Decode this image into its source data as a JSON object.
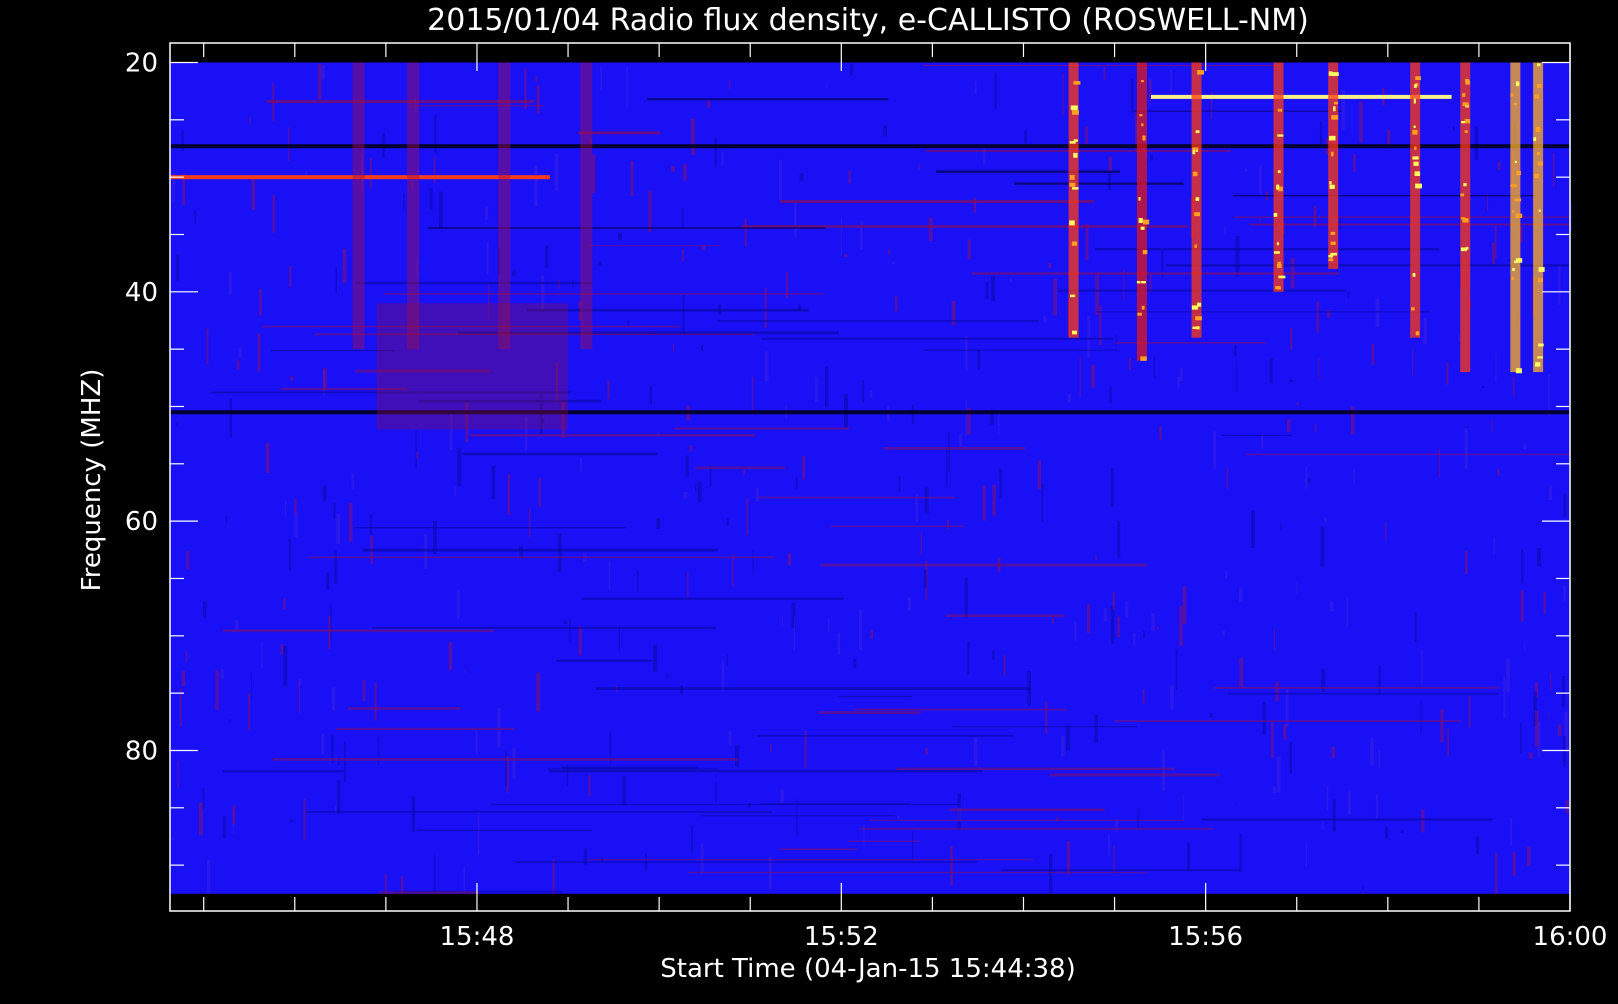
{
  "chart_data": {
    "type": "heatmap",
    "title": "2015/01/04  Radio flux density, e-CALLISTO (ROSWELL-NM)",
    "xlabel": "Start Time (04-Jan-15 15:44:38)",
    "ylabel": "Frequency (MHZ)",
    "x_start": "15:44:38",
    "x_end": "16:00:00",
    "xlim_minutes": [
      44.63,
      60.0
    ],
    "ylim": [
      18.3,
      94.0
    ],
    "y_inverted": true,
    "data_range_mhz": [
      20,
      92.5
    ],
    "x_ticks": [
      {
        "label": "15:48",
        "minute": 48
      },
      {
        "label": "15:52",
        "minute": 52
      },
      {
        "label": "15:56",
        "minute": 56
      },
      {
        "label": "16:00",
        "minute": 60
      }
    ],
    "x_minor_ticks_minutes": [
      45,
      46,
      47,
      49,
      50,
      51,
      53,
      54,
      55,
      57,
      58,
      59
    ],
    "y_ticks": [
      {
        "label": "20",
        "value": 20
      },
      {
        "label": "40",
        "value": 40
      },
      {
        "label": "60",
        "value": 60
      },
      {
        "label": "80",
        "value": 80
      }
    ],
    "y_minor_ticks": [
      25,
      30,
      35,
      45,
      50,
      55,
      65,
      70,
      75,
      85,
      90
    ],
    "colormap": [
      "#000000",
      "#0000ff",
      "#ff0000",
      "#ffff00",
      "#ffffff"
    ],
    "background_color": "#1a10f5",
    "grid": false,
    "features": [
      {
        "kind": "bright_band",
        "freq_mhz": 23.0,
        "start_minute": 55.4,
        "end_minute": 58.7,
        "intensity": "high"
      },
      {
        "kind": "dark_band",
        "freq_mhz": 27.3,
        "start_minute": 44.63,
        "end_minute": 60.0
      },
      {
        "kind": "bright_band",
        "freq_mhz": 30.0,
        "start_minute": 44.63,
        "end_minute": 48.8,
        "intensity": "medium"
      },
      {
        "kind": "dark_band",
        "freq_mhz": 50.5,
        "start_minute": 44.63,
        "end_minute": 60.0
      },
      {
        "kind": "burst_column",
        "minute": 54.55,
        "freq_range_mhz": [
          20,
          44
        ],
        "intensity": "high"
      },
      {
        "kind": "burst_column",
        "minute": 55.3,
        "freq_range_mhz": [
          20,
          46
        ],
        "intensity": "medium"
      },
      {
        "kind": "burst_column",
        "minute": 55.9,
        "freq_range_mhz": [
          20,
          44
        ],
        "intensity": "high"
      },
      {
        "kind": "burst_column",
        "minute": 56.8,
        "freq_range_mhz": [
          20,
          40
        ],
        "intensity": "high"
      },
      {
        "kind": "burst_column",
        "minute": 57.4,
        "freq_range_mhz": [
          20,
          38
        ],
        "intensity": "high"
      },
      {
        "kind": "burst_column",
        "minute": 58.3,
        "freq_range_mhz": [
          20,
          44
        ],
        "intensity": "high"
      },
      {
        "kind": "burst_column",
        "minute": 58.85,
        "freq_range_mhz": [
          20,
          47
        ],
        "intensity": "high"
      },
      {
        "kind": "burst_column",
        "minute": 59.4,
        "freq_range_mhz": [
          20,
          47
        ],
        "intensity": "very_high"
      },
      {
        "kind": "burst_column",
        "minute": 59.65,
        "freq_range_mhz": [
          20,
          47
        ],
        "intensity": "very_high"
      },
      {
        "kind": "weak_column",
        "minute": 46.7,
        "freq_range_mhz": [
          20,
          45
        ],
        "intensity": "low"
      },
      {
        "kind": "weak_column",
        "minute": 47.3,
        "freq_range_mhz": [
          20,
          45
        ],
        "intensity": "low"
      },
      {
        "kind": "weak_column",
        "minute": 48.3,
        "freq_range_mhz": [
          20,
          45
        ],
        "intensity": "low"
      },
      {
        "kind": "weak_column",
        "minute": 49.2,
        "freq_range_mhz": [
          20,
          45
        ],
        "intensity": "low"
      },
      {
        "kind": "reddish_patch",
        "minute_range": [
          46.9,
          49.0
        ],
        "freq_range_mhz": [
          41,
          52
        ],
        "intensity": "low"
      }
    ]
  }
}
